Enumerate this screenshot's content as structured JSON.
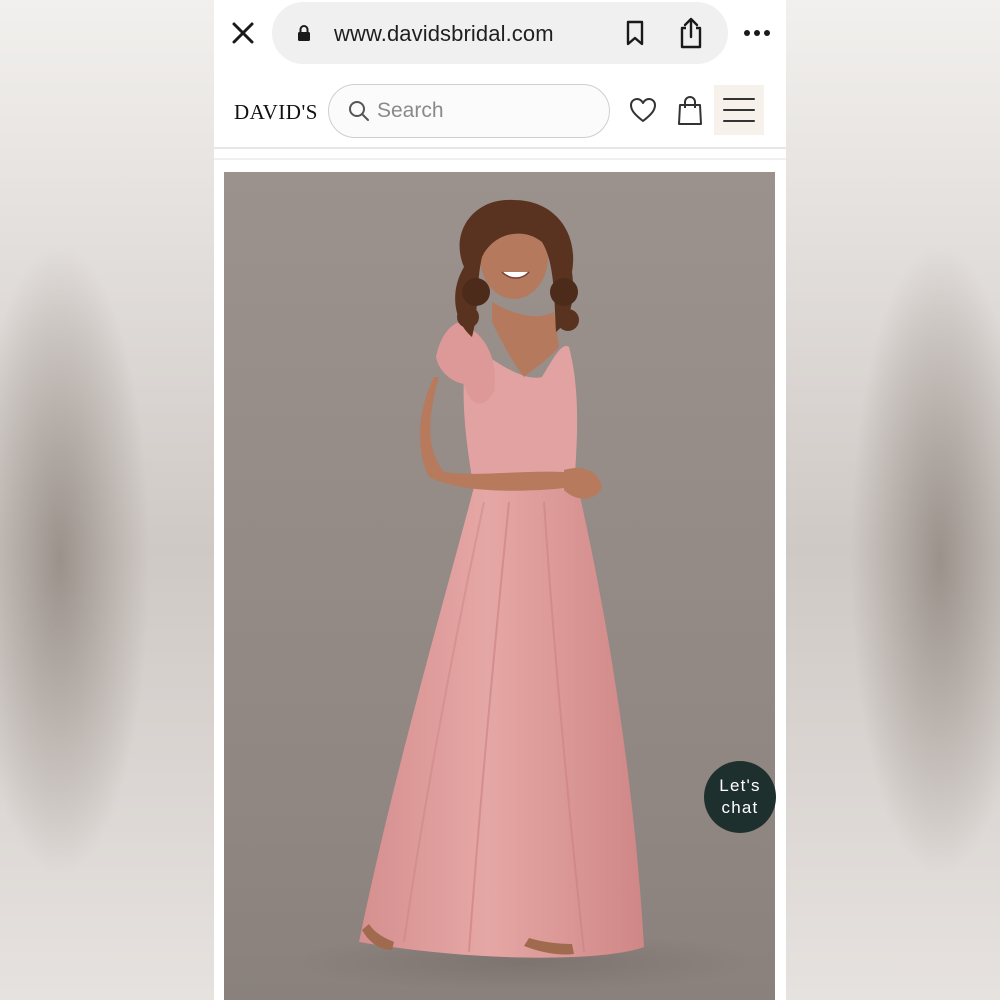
{
  "browser": {
    "url": "www.davidsbridal.com",
    "icons": [
      "close-icon",
      "lock-icon",
      "bookmark-icon",
      "share-icon",
      "more-icon"
    ]
  },
  "header": {
    "logo": "DAVID'S",
    "search": {
      "placeholder": "Search"
    },
    "icons": [
      "search-icon",
      "heart-icon",
      "shopping-bag-icon",
      "menu-icon"
    ]
  },
  "product": {
    "dress_color": "#e0a0a0",
    "background_color": "#958b87"
  },
  "chat": {
    "line1": "Let's",
    "line2": "chat"
  }
}
